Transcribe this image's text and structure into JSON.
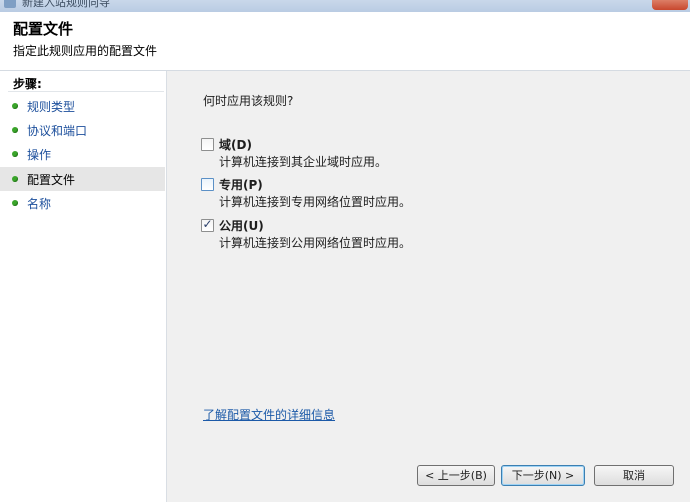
{
  "window": {
    "title": "新建入站规则向导"
  },
  "header": {
    "title": "配置文件",
    "subtitle": "指定此规则应用的配置文件"
  },
  "sidebar": {
    "title": "步骤:",
    "items": [
      {
        "label": "规则类型",
        "active": false
      },
      {
        "label": "协议和端口",
        "active": false
      },
      {
        "label": "操作",
        "active": false
      },
      {
        "label": "配置文件",
        "active": true
      },
      {
        "label": "名称",
        "active": false
      }
    ]
  },
  "main": {
    "question": "何时应用该规则?",
    "options": [
      {
        "label": "域(D)",
        "description": "计算机连接到其企业域时应用。",
        "checked": false
      },
      {
        "label": "专用(P)",
        "description": "计算机连接到专用网络位置时应用。",
        "checked": false
      },
      {
        "label": "公用(U)",
        "description": "计算机连接到公用网络位置时应用。",
        "checked": true
      }
    ],
    "checked_mark": "✓",
    "learn_more_link": "了解配置文件的详细信息"
  },
  "buttons": {
    "back": "< 上一步(B)",
    "next": "下一步(N) >",
    "cancel": "取消"
  },
  "colors": {
    "step_dot": "#3aa52a",
    "link": "#1c5aa8"
  }
}
